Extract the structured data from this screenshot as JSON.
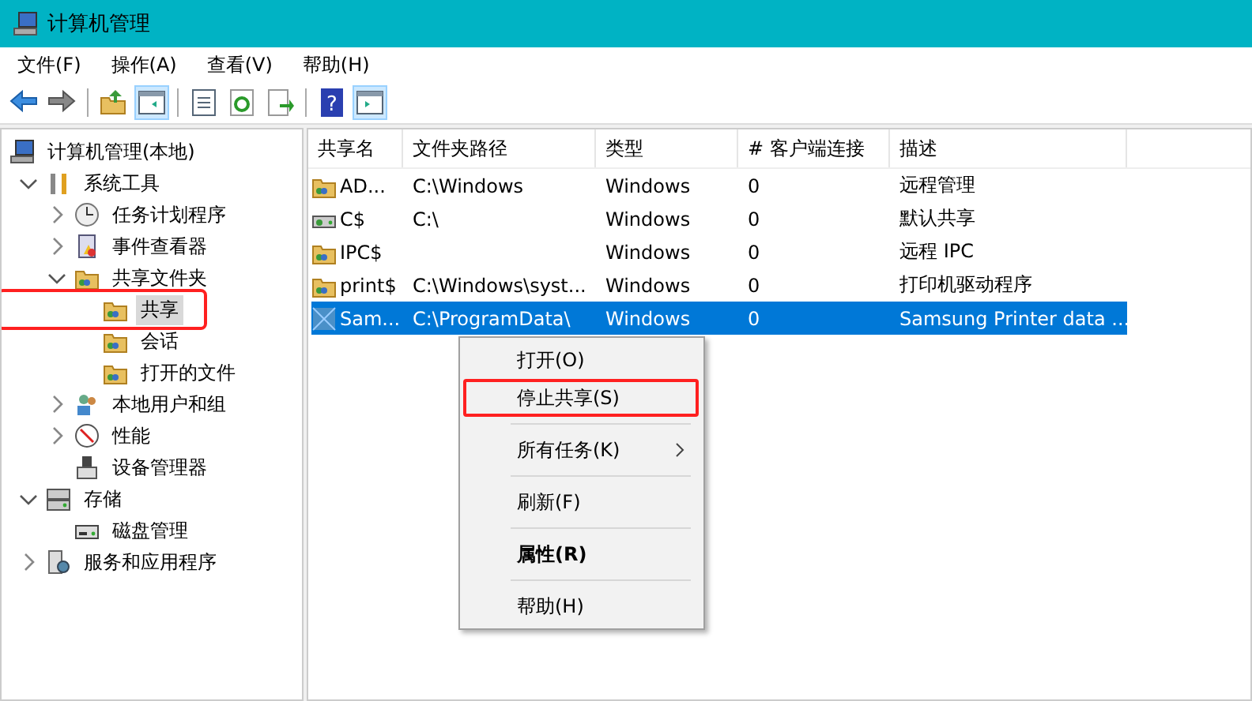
{
  "window": {
    "title": "计算机管理"
  },
  "menu_bar": [
    "文件(F)",
    "操作(A)",
    "查看(V)",
    "帮助(H)"
  ],
  "toolbar": [
    {
      "kind": "back",
      "pressed": false
    },
    {
      "kind": "forward",
      "pressed": false
    },
    {
      "kind": "separator"
    },
    {
      "kind": "up",
      "pressed": false
    },
    {
      "kind": "pane",
      "pressed": true
    },
    {
      "kind": "separator"
    },
    {
      "kind": "properties",
      "pressed": false
    },
    {
      "kind": "refresh",
      "pressed": false
    },
    {
      "kind": "export",
      "pressed": false
    },
    {
      "kind": "separator"
    },
    {
      "kind": "help",
      "glyph": "?",
      "pressed": false
    },
    {
      "kind": "action-pane",
      "pressed": true
    }
  ],
  "tree": [
    {
      "label": "计算机管理(本地)",
      "kind": "computer",
      "selected": false,
      "highlighted": false,
      "children": [
        {
          "label": "系统工具",
          "kind": "tools",
          "expanded": true,
          "selected": false,
          "highlighted": false,
          "children": [
            {
              "label": "任务计划程序",
              "kind": "clock",
              "expanded": false,
              "selected": false,
              "highlighted": false
            },
            {
              "label": "事件查看器",
              "kind": "log",
              "expanded": false,
              "selected": false,
              "highlighted": false
            },
            {
              "label": "共享文件夹",
              "kind": "share",
              "expanded": true,
              "selected": false,
              "highlighted": false,
              "children": [
                {
                  "label": "共享",
                  "kind": "share",
                  "selected": true,
                  "highlighted": true
                },
                {
                  "label": "会话",
                  "kind": "share",
                  "selected": false,
                  "highlighted": false
                },
                {
                  "label": "打开的文件",
                  "kind": "share",
                  "selected": false,
                  "highlighted": false
                }
              ]
            },
            {
              "label": "本地用户和组",
              "kind": "users",
              "expanded": false,
              "selected": false,
              "highlighted": false
            },
            {
              "label": "性能",
              "kind": "gauge",
              "expanded": false,
              "selected": false,
              "highlighted": false
            },
            {
              "label": "设备管理器",
              "kind": "device",
              "selected": false,
              "highlighted": false
            }
          ]
        },
        {
          "label": "存储",
          "kind": "storage",
          "expanded": true,
          "selected": false,
          "highlighted": false,
          "children": [
            {
              "label": "磁盘管理",
              "kind": "disk",
              "selected": false,
              "highlighted": false
            }
          ]
        },
        {
          "label": "服务和应用程序",
          "kind": "services",
          "expanded": false,
          "selected": false,
          "highlighted": false
        }
      ]
    }
  ],
  "table": {
    "columns": [
      "共享名",
      "文件夹路径",
      "类型",
      "# 客户端连接",
      "描述"
    ],
    "rows": [
      {
        "kind": "share",
        "cells": [
          "AD...",
          "C:\\Windows",
          "Windows",
          "0",
          "远程管理"
        ],
        "selected": false
      },
      {
        "kind": "drive",
        "cells": [
          "C$",
          "C:\\",
          "Windows",
          "0",
          "默认共享"
        ],
        "selected": false
      },
      {
        "kind": "share",
        "cells": [
          "IPC$",
          "",
          "Windows",
          "0",
          "远程 IPC"
        ],
        "selected": false
      },
      {
        "kind": "share",
        "cells": [
          "print$",
          "C:\\Windows\\syst...",
          "Windows",
          "0",
          "打印机驱动程序"
        ],
        "selected": false
      },
      {
        "kind": "printer",
        "cells": [
          "Sam...",
          "C:\\ProgramData\\",
          "Windows",
          "0",
          "Samsung Printer data ..."
        ],
        "selected": true
      }
    ]
  },
  "context_menu": [
    {
      "kind": "item",
      "label": "打开(O)",
      "bold": false,
      "submenu": false,
      "highlighted": false
    },
    {
      "kind": "item",
      "label": "停止共享(S)",
      "bold": false,
      "submenu": false,
      "highlighted": true
    },
    {
      "kind": "separator"
    },
    {
      "kind": "item",
      "label": "所有任务(K)",
      "bold": false,
      "submenu": true,
      "highlighted": false
    },
    {
      "kind": "separator"
    },
    {
      "kind": "item",
      "label": "刷新(F)",
      "bold": false,
      "submenu": false,
      "highlighted": false
    },
    {
      "kind": "separator"
    },
    {
      "kind": "item",
      "label": "属性(R)",
      "bold": true,
      "submenu": false,
      "highlighted": false
    },
    {
      "kind": "separator"
    },
    {
      "kind": "item",
      "label": "帮助(H)",
      "bold": false,
      "submenu": false,
      "highlighted": false
    }
  ]
}
